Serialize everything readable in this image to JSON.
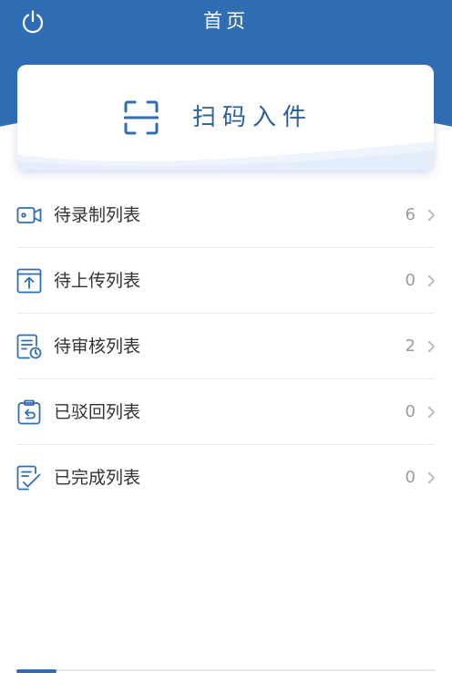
{
  "header": {
    "title": "首页",
    "bg_color": "#2f6db4",
    "power_icon": "power-icon"
  },
  "scan_card": {
    "label": "扫码入件",
    "icon": "scan-icon"
  },
  "list": {
    "items": [
      {
        "label": "待录制列表",
        "count": "6",
        "icon": "video-camera-icon"
      },
      {
        "label": "待上传列表",
        "count": "0",
        "icon": "upload-icon"
      },
      {
        "label": "待审核列表",
        "count": "2",
        "icon": "review-clock-icon"
      },
      {
        "label": "已驳回列表",
        "count": "0",
        "icon": "clipboard-return-icon"
      },
      {
        "label": "已完成列表",
        "count": "0",
        "icon": "document-check-icon"
      }
    ]
  }
}
